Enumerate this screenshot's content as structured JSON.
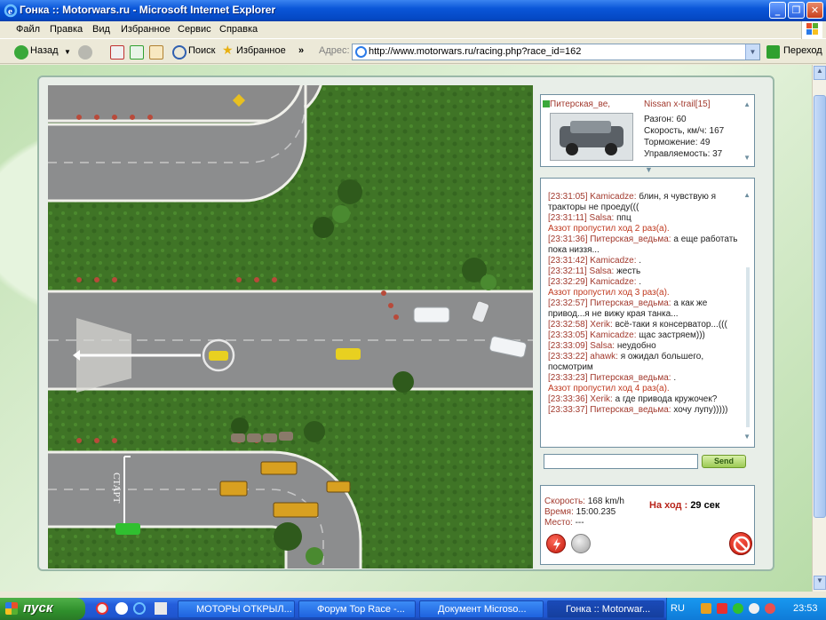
{
  "window": {
    "title": "Гонка :: Motorwars.ru - Microsoft Internet Explorer"
  },
  "menu": [
    "Файл",
    "Правка",
    "Вид",
    "Избранное",
    "Сервис",
    "Справка"
  ],
  "toolbar": {
    "back": "Назад",
    "search": "Поиск",
    "favorites": "Избранное",
    "address_label": "Адрес:",
    "address": "http://www.motorwars.ru/racing.php?race_id=162",
    "go": "Переход"
  },
  "map": {
    "start_label": "СТАРТ"
  },
  "car": {
    "player": "Питерская_ве,",
    "model": "Nissan x-trail[15]",
    "stats": [
      "Разгон: 60",
      "Скорость, км/ч: 167",
      "Торможение: 49",
      "Управляемость: 37"
    ]
  },
  "chat": [
    {
      "time": "[23:31:05]",
      "name": "Kamicadze:",
      "text": "блин, я чувствую я тракторы не проеду((("
    },
    {
      "time": "[23:31:11]",
      "name": "Salsa:",
      "text": "ппц"
    },
    {
      "sys": "Аззот пропустил ход 2 раз(а)."
    },
    {
      "time": "[23:31:36]",
      "name": "Питерская_ведьма:",
      "text": "а еще работать пока низзя..."
    },
    {
      "time": "[23:31:42]",
      "name": "Kamicadze:",
      "text": "."
    },
    {
      "time": "[23:32:11]",
      "name": "Salsa:",
      "text": "жесть"
    },
    {
      "time": "[23:32:29]",
      "name": "Kamicadze:",
      "text": "."
    },
    {
      "sys": "Аззот пропустил ход 3 раз(а)."
    },
    {
      "time": "[23:32:57]",
      "name": "Питерская_ведьма:",
      "text": "а как же привод...я не вижу края танка..."
    },
    {
      "time": "[23:32:58]",
      "name": "Xerik:",
      "text": "всё-таки я консерватор...((("
    },
    {
      "time": "[23:33:05]",
      "name": "Kamicadze:",
      "text": "щас застряем)))"
    },
    {
      "time": "[23:33:09]",
      "name": "Salsa:",
      "text": "неудобно"
    },
    {
      "time": "[23:33:22]",
      "name": "ahawk:",
      "text": "я ожидал большего, посмотрим"
    },
    {
      "time": "[23:33:23]",
      "name": "Питерская_ведьма:",
      "text": "."
    },
    {
      "sys": "Аззот пропустил ход 4 раз(а)."
    },
    {
      "time": "[23:33:36]",
      "name": "Xerik:",
      "text": "а где привода кружочек?"
    },
    {
      "time": "[23:33:37]",
      "name": "Питерская_ведьма:",
      "text": "хочу лупу)))))"
    }
  ],
  "send_label": "Send",
  "race": {
    "speed_label": "Скорость:",
    "speed": "168 km/h",
    "time_label": "Время:",
    "time": "15:00.235",
    "place_label": "Место:",
    "place": "---",
    "turn_label": "На ход :",
    "turn": "29 сек"
  },
  "taskbar": {
    "start": "пуск",
    "items": [
      "МОТОРЫ ОТКРЫЛ...",
      "Форум Top Race -...",
      "Документ Microso...",
      "Гонка :: Motorwar..."
    ],
    "lang": "RU",
    "clock": "23:53"
  }
}
